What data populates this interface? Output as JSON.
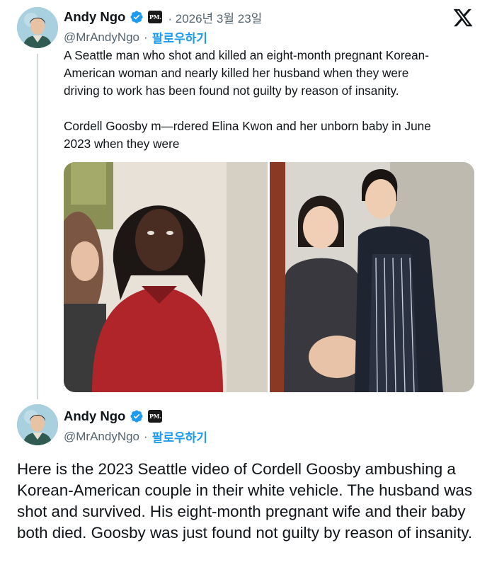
{
  "tweet1": {
    "author_name": "Andy Ngo",
    "handle": "@MrAndyNgo",
    "separator": "·",
    "follow_label": "팔로우하기",
    "date": "· 2026년 3월 23일",
    "badge_text": "PM.",
    "body": "A Seattle man who shot and killed an eight-month pregnant Korean-\nAmerican woman and nearly killed her husband when they were\ndriving to work has been found not guilty by reason of insanity.\n\nCordell Goosby m—rdered Elina Kwon and her unborn baby in June\n2023 when they were"
  },
  "tweet2": {
    "author_name": "Andy Ngo",
    "handle": "@MrAndyNgo",
    "separator": "·",
    "follow_label": "팔로우하기",
    "badge_text": "PM.",
    "body": "Here is the 2023 Seattle video of Cordell Goosby ambushing a Korean-American couple in their white vehicle. The husband was shot and survived. His eight-month pregnant wife and their baby both died. Goosby was just found not guilty by reason of insanity."
  },
  "icons": {
    "verified": "verified-badge-icon",
    "x_logo": "x-logo-icon"
  },
  "colors": {
    "accent": "#1d9bf0",
    "text": "#0f1419",
    "muted": "#536471",
    "thread_line": "#cfd9de"
  }
}
